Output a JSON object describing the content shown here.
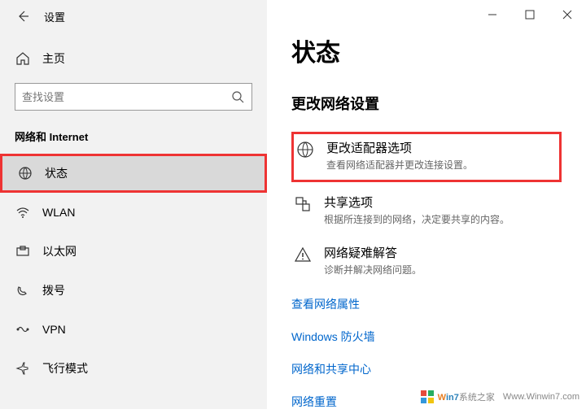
{
  "titlebar": {
    "title": "设置"
  },
  "sidebar": {
    "home": "主页",
    "search_placeholder": "查找设置",
    "section": "网络和 Internet",
    "items": [
      {
        "label": "状态"
      },
      {
        "label": "WLAN"
      },
      {
        "label": "以太网"
      },
      {
        "label": "拨号"
      },
      {
        "label": "VPN"
      },
      {
        "label": "飞行模式"
      }
    ]
  },
  "main": {
    "title": "状态",
    "subheading": "更改网络设置",
    "options": [
      {
        "title": "更改适配器选项",
        "desc": "查看网络适配器并更改连接设置。"
      },
      {
        "title": "共享选项",
        "desc": "根据所连接到的网络，决定要共享的内容。"
      },
      {
        "title": "网络疑难解答",
        "desc": "诊断并解决网络问题。"
      }
    ],
    "links": [
      "查看网络属性",
      "Windows 防火墙",
      "网络和共享中心",
      "网络重置"
    ]
  },
  "watermark": {
    "brand": "Win7系统之家",
    "url": "Www.Winwin7.com"
  }
}
